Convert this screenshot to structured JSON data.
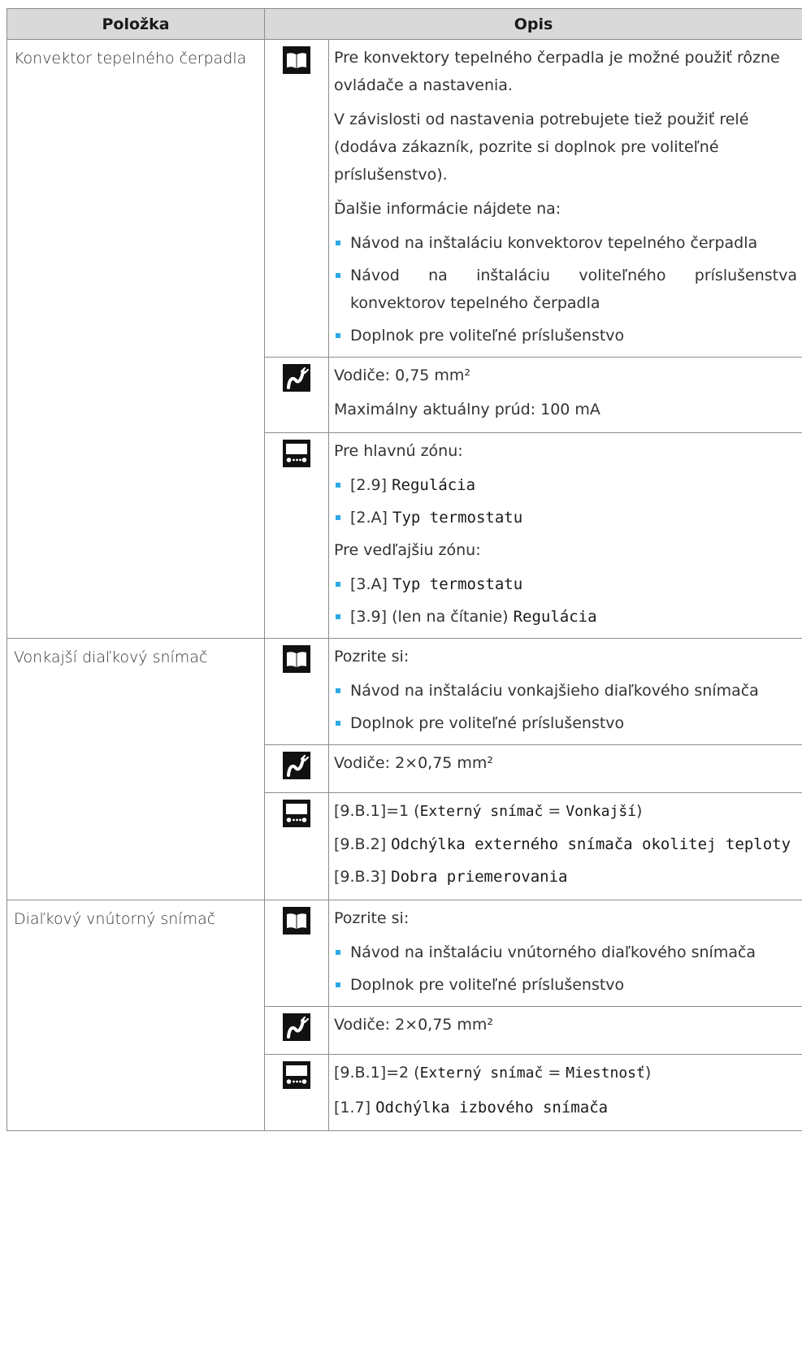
{
  "header": {
    "col_item": "Položka",
    "col_desc": "Opis"
  },
  "icons": {
    "manual": "book-icon",
    "wiring": "wire-icon",
    "settings": "user-interface-icon"
  },
  "accent_color": "#2ea8e5",
  "rows": {
    "convector": {
      "item": "Konvektor tepelného čerpadla",
      "manual": {
        "p1": "Pre konvektory tepelného čerpadla je možné použiť rôzne ovládače a nastavenia.",
        "p2": "V závislosti od nastavenia potrebujete tiež použiť relé (dodáva zákazník, pozrite si doplnok pre voliteľné príslušenstvo).",
        "p3": "Ďalšie informácie nájdete na:",
        "b1": "Návod na inštaláciu konvektorov tepelného čerpadla",
        "b2": "Návod na inštaláciu voliteľného príslušenstva konvektorov tepelného čerpadla",
        "b3": "Doplnok pre voliteľné príslušenstvo"
      },
      "wiring": {
        "p1": "Vodiče: 0,75 mm²",
        "p2": "Maximálny aktuálny prúd: 100 mA"
      },
      "settings": {
        "main_zone": "Pre hlavnú zónu:",
        "b1_code": "[2.9]",
        "b1_name": "Regulácia",
        "b2_code": "[2.A]",
        "b2_name": "Typ termostatu",
        "add_zone": "Pre vedľajšiu zónu:",
        "b3_code": "[3.A]",
        "b3_name": "Typ termostatu",
        "b4_code": "[3.9] (len na čítanie)",
        "b4_name": "Regulácia"
      }
    },
    "outdoor": {
      "item": "Vonkajší diaľkový snímač",
      "manual": {
        "p1": "Pozrite si:",
        "b1": "Návod na inštaláciu vonkajšieho diaľkového snímača",
        "b2": "Doplnok pre voliteľné príslušenstvo"
      },
      "wiring": {
        "p1": "Vodiče: 2×0,75 mm²"
      },
      "settings": {
        "l1_code": "[9.B.1]=1 (",
        "l1_name": "Externý snímač",
        "l1_eq": " = ",
        "l1_value": "Vonkajší",
        "l1_close": ")",
        "l2_code": "[9.B.2] ",
        "l2_name": "Odchýlka externého snímača okolitej teploty",
        "l3_code": "[9.B.3] ",
        "l3_name": "Dobra priemerovania"
      }
    },
    "indoor": {
      "item": "Diaľkový vnútorný snímač",
      "manual": {
        "p1": "Pozrite si:",
        "b1": "Návod na inštaláciu vnútorného diaľkového snímača",
        "b2": "Doplnok pre voliteľné príslušenstvo"
      },
      "wiring": {
        "p1": "Vodiče: 2×0,75 mm²"
      },
      "settings": {
        "l1_code": "[9.B.1]=2 (",
        "l1_name": "Externý snímač",
        "l1_eq": " = ",
        "l1_value": "Miestnosť",
        "l1_close": ")",
        "l2_code": "[1.7] ",
        "l2_name": "Odchýlka izbového snímača"
      }
    }
  }
}
